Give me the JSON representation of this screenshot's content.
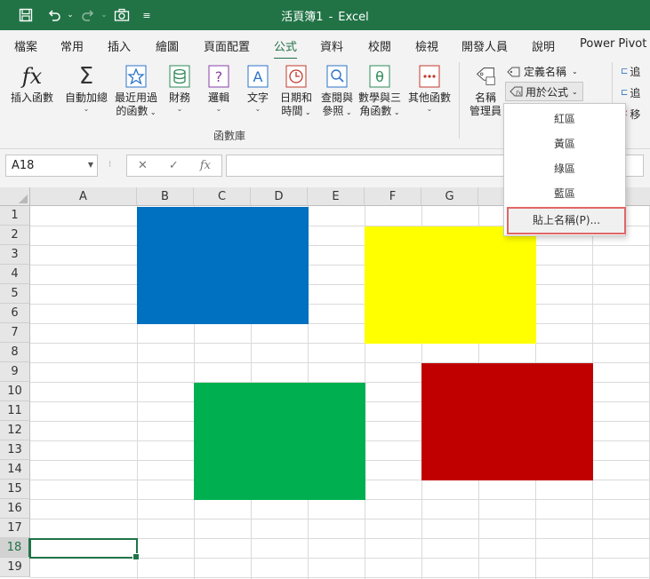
{
  "titlebar": {
    "workbook": "活頁簿1",
    "separator": "-",
    "app": "Excel"
  },
  "tabs": [
    "檔案",
    "常用",
    "插入",
    "繪圖",
    "頁面配置",
    "公式",
    "資料",
    "校閱",
    "檢視",
    "開發人員",
    "說明",
    "Power Pivot"
  ],
  "ribbon": {
    "insert_function": {
      "label": "插入函數",
      "icon": "fx"
    },
    "buttons": [
      {
        "label1": "自動加總",
        "label2": "",
        "icon": "Σ"
      },
      {
        "label1": "最近用過",
        "label2": "的函數",
        "icon": "★"
      },
      {
        "label1": "財務",
        "label2": "",
        "icon": "financial-icon"
      },
      {
        "label1": "邏輯",
        "label2": "",
        "icon": "?"
      },
      {
        "label1": "文字",
        "label2": "",
        "icon": "A"
      },
      {
        "label1": "日期和",
        "label2": "時間",
        "icon": "clock-icon"
      },
      {
        "label1": "查閱與",
        "label2": "參照",
        "icon": "search-icon"
      },
      {
        "label1": "數學與三",
        "label2": "角函數",
        "icon": "θ"
      },
      {
        "label1": "其他函數",
        "label2": "",
        "icon": "more-icon"
      }
    ],
    "group_label": "函數庫",
    "name_manager": {
      "label1": "名稱",
      "label2": "管理員"
    },
    "define_name": "定義名稱",
    "use_in_formula": "用於公式",
    "right_cut": [
      "追",
      "追",
      "移"
    ]
  },
  "formula_bar": {
    "name_box": "A18",
    "cancel": "✕",
    "enter": "✓",
    "fx": "fx",
    "formula": ""
  },
  "grid": {
    "columns": [
      "A",
      "B",
      "C",
      "D",
      "E",
      "F",
      "G"
    ],
    "rows": [
      "1",
      "2",
      "3",
      "4",
      "5",
      "6",
      "7",
      "8",
      "9",
      "10",
      "11",
      "12",
      "13",
      "14",
      "15",
      "16",
      "17",
      "18",
      "19"
    ],
    "selected_row": "18"
  },
  "shapes": {
    "blue": "#0070C0",
    "yellow": "#FFFF00",
    "green": "#00B050",
    "red": "#C00000"
  },
  "dropdown": {
    "items": [
      "紅區",
      "黃區",
      "綠區",
      "藍區"
    ],
    "paste_names": "貼上名稱(P)..."
  },
  "colors": {
    "accent": "#217346",
    "highlight_border": "#e06666"
  }
}
